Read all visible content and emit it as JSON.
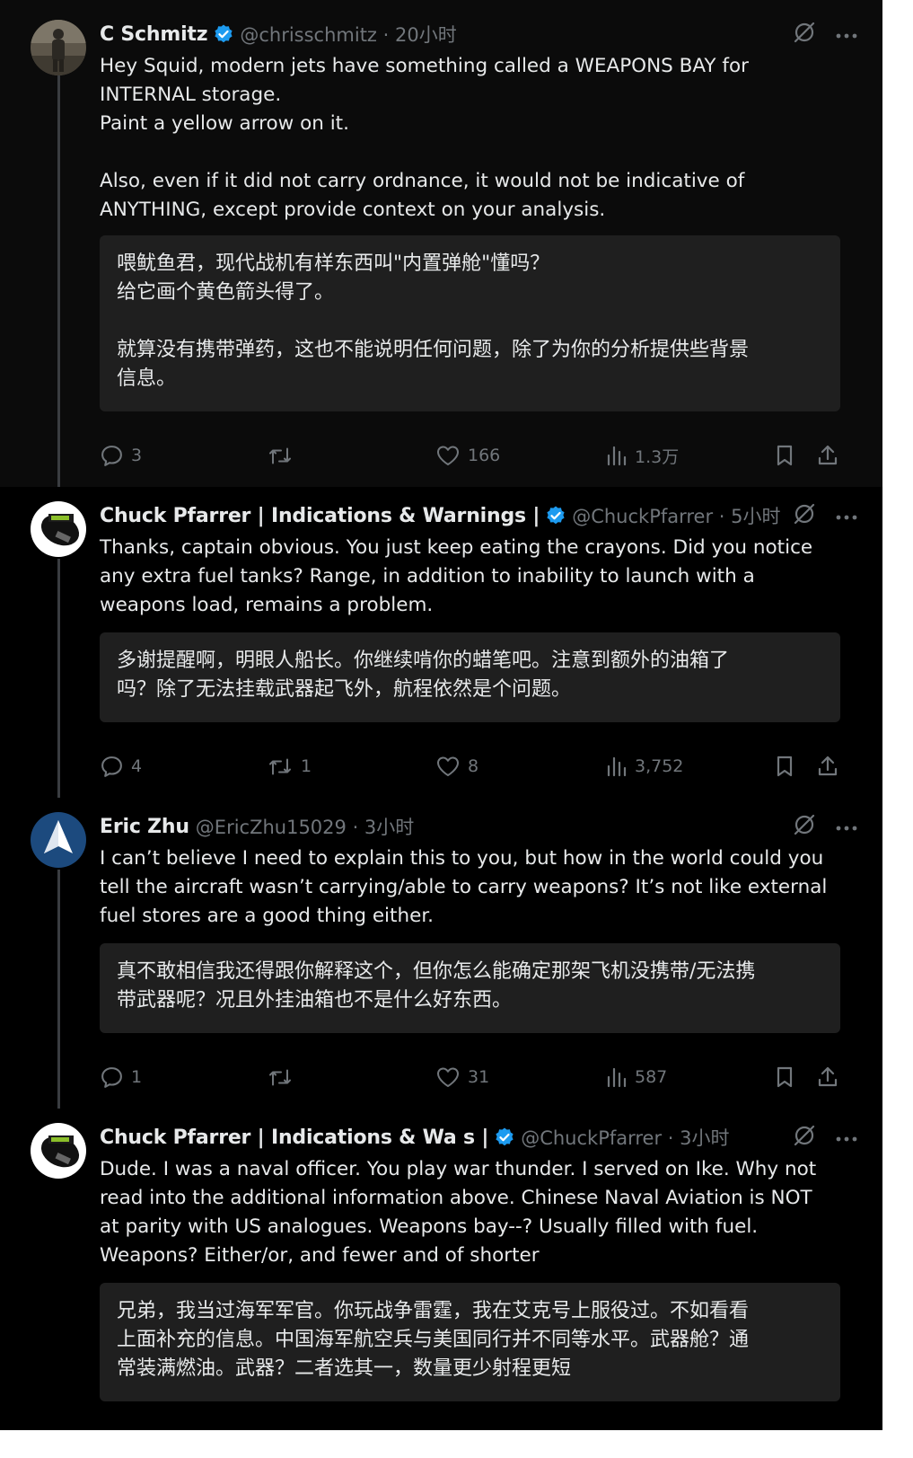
{
  "colors": {
    "background": "#000000",
    "text": "#e7e9ea",
    "muted": "#71767b",
    "verified": "#1d9bf0",
    "translation_box": "#1f1f1f"
  },
  "icons": {
    "verified": "verified-badge-icon",
    "grok": "grok-icon",
    "more": "more-icon",
    "reply": "reply-icon",
    "repost": "repost-icon",
    "like": "like-icon",
    "views": "views-icon",
    "bookmark": "bookmark-icon",
    "share": "share-icon"
  },
  "posts": [
    {
      "name": "C Schmitz",
      "handle": "@chrisschmitz · 20小时",
      "text": "Hey Squid, modern jets have something called a WEAPONS BAY for\nINTERNAL storage.\nPaint a yellow arrow on it.\n\nAlso, even if it did not carry ordnance, it would not be indicative of\nANYTHING, except provide context on your analysis.",
      "translation": "喂鱿鱼君，现代战机有样东西叫\"内置弹舱\"懂吗？\n给它画个黄色箭头得了。\n\n就算没有携带弹药，这也不能说明任何问题，除了为你的分析提供些背景\n信息。",
      "replies": "3",
      "reposts": "",
      "likes": "166",
      "views": "1.3万"
    },
    {
      "name": "Chuck Pfarrer | Indications & Warnings |",
      "handle": "@ChuckPfarrer · 5小时",
      "text": "Thanks, captain obvious.  You just keep eating the crayons.  Did you notice\nany extra fuel tanks?  Range, in addition to inability to launch with a\nweapons load, remains a problem.",
      "translation": "多谢提醒啊，明眼人船长。你继续啃你的蜡笔吧。注意到额外的油箱了\n吗？除了无法挂载武器起飞外，航程依然是个问题。",
      "replies": "4",
      "reposts": "1",
      "likes": "8",
      "views": "3,752"
    },
    {
      "name": "Eric Zhu",
      "handle": "@EricZhu15029 · 3小时",
      "text": "I can’t believe I need to explain this to you, but how in the world could you\ntell the aircraft wasn’t carrying/able to carry weapons? It’s not like external\nfuel stores are a good thing either.",
      "translation": "真不敢相信我还得跟你解释这个，但你怎么能确定那架飞机没携带/无法携\n带武器呢？况且外挂油箱也不是什么好东西。",
      "replies": "1",
      "reposts": "",
      "likes": "31",
      "views": "587"
    },
    {
      "name": "Chuck Pfarrer | Indications & Wa    s |",
      "handle": "@ChuckPfarrer · 3小时",
      "text": "Dude.  I was a naval officer.   You play war thunder. I served on Ike. Why not\nread into the additional information above.  Chinese Naval Aviation is NOT\nat parity with US analogues.    Weapons bay--?  Usually filled with fuel.\nWeapons?  Either/or, and fewer and of shorter",
      "translation": "兄弟，我当过海军军官。你玩战争雷霆，我在艾克号上服役过。不如看看\n上面补充的信息。中国海军航空兵与美国同行并不同等水平。武器舱？通\n常装满燃油。武器？二者选其一，数量更少射程更短",
      "replies": "",
      "reposts": "",
      "likes": "",
      "views": ""
    }
  ]
}
